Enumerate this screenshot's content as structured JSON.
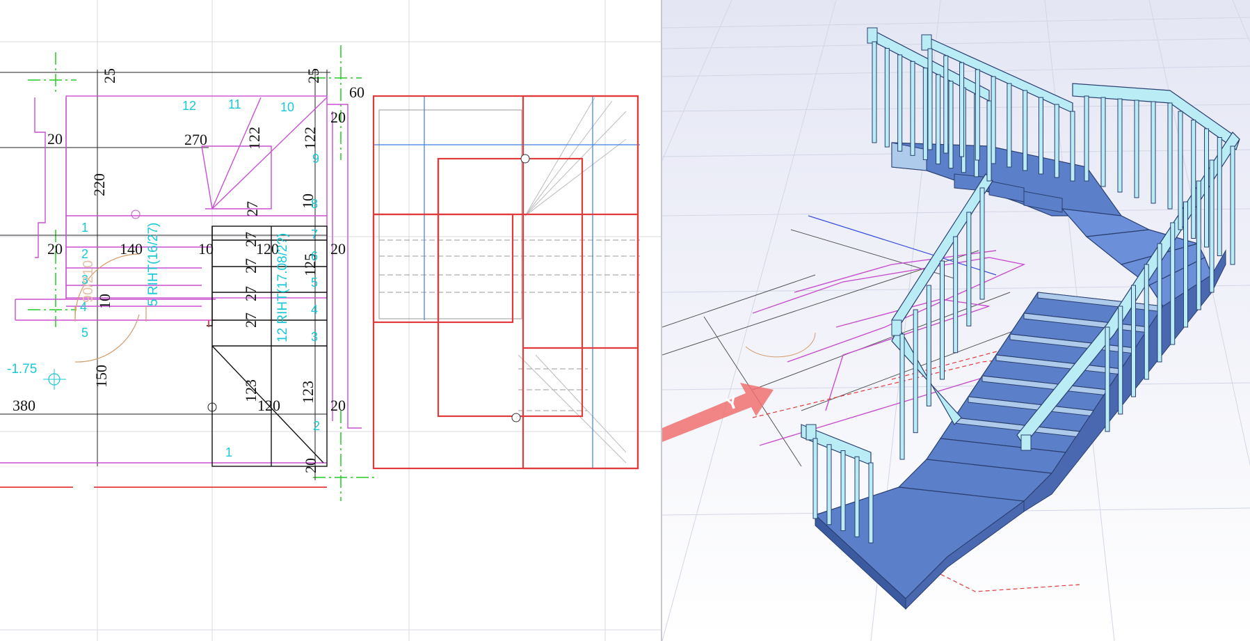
{
  "plan": {
    "dimensions": {
      "d25a": "25",
      "d25b": "25",
      "d60": "60",
      "d20_top": "20",
      "d270": "270",
      "d122a": "122",
      "d122b": "122",
      "d20_left": "20",
      "d220": "220",
      "d20_mid": "20",
      "d140": "140",
      "d10a": "10",
      "d120a": "120",
      "d10b": "10",
      "d20_r1": "20",
      "d27a": "27",
      "d27b": "27",
      "d27c": "27",
      "d27d": "27",
      "d27e": "27",
      "d125": "125",
      "d10c": "10",
      "d150": "150",
      "d380": "380",
      "d123a": "123",
      "d120b": "120",
      "d123b": "123",
      "d20_r2": "20",
      "d20_bot": "20"
    },
    "steps": {
      "s12": "12",
      "s11": "11",
      "s10": "10",
      "s9": "9",
      "s8": "8",
      "s7": "7",
      "s6": "6",
      "s5r": "5",
      "s4r": "4",
      "s3r": "3",
      "s2r": "2",
      "s1r": "1",
      "s1l": "1",
      "s2l": "2",
      "s3l": "3",
      "s4l": "4",
      "s5l": "5"
    },
    "labels": {
      "flight_left": "5 RIHT(16/27)",
      "flight_right": "12 RIHT(17.08/2?)",
      "door": "90/210",
      "level": "-1.75"
    }
  },
  "view3d": {
    "axis_label": "Y",
    "colors": {
      "tread": "#5b7fc9",
      "riser": "#aecbeb",
      "rail": "#b9ecf5",
      "dimension_red": "#e23a3a",
      "dimension_magenta": "#c84fd1"
    }
  }
}
